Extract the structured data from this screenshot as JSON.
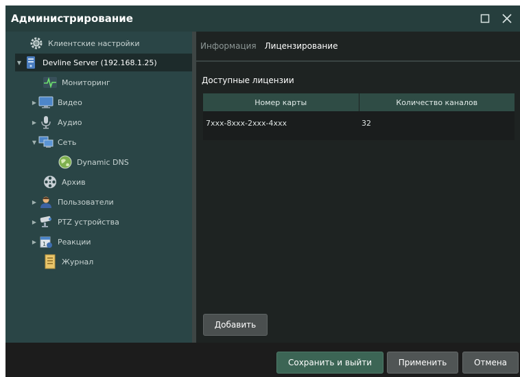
{
  "window": {
    "title": "Администрирование"
  },
  "sidebar": {
    "items": [
      {
        "label": "Клиентские настройки",
        "icon": "gear-icon"
      },
      {
        "label": "Devline Server (192.168.1.25)",
        "icon": "server-icon"
      },
      {
        "label": "Мониторинг",
        "icon": "pulse-icon"
      },
      {
        "label": "Видео",
        "icon": "monitor-icon"
      },
      {
        "label": "Аудио",
        "icon": "microphone-icon"
      },
      {
        "label": "Сеть",
        "icon": "network-icon"
      },
      {
        "label": "Dynamic DNS",
        "icon": "globe-icon"
      },
      {
        "label": "Архив",
        "icon": "film-reel-icon"
      },
      {
        "label": "Пользователи",
        "icon": "user-icon"
      },
      {
        "label": "PTZ устройства",
        "icon": "ptz-camera-icon"
      },
      {
        "label": "Реакции",
        "icon": "calendar-icon"
      },
      {
        "label": "Журнал",
        "icon": "log-icon"
      }
    ]
  },
  "tabs": [
    {
      "label": "Информация",
      "active": false
    },
    {
      "label": "Лицензирование",
      "active": true
    }
  ],
  "licenses": {
    "title": "Доступные лицензии",
    "columns": [
      "Номер карты",
      "Количество каналов"
    ],
    "rows": [
      {
        "card": "7xxx-8xxx-2xxx-4xxx",
        "channels": "32"
      }
    ],
    "add_label": "Добавить"
  },
  "footer": {
    "save_exit": "Сохранить и выйти",
    "apply": "Применить",
    "cancel": "Отмена"
  },
  "colors": {
    "titlebar": "#263e3d",
    "sidebar": "#2a4546",
    "primary_button": "#3c6555",
    "table_header": "#2f4c45"
  }
}
